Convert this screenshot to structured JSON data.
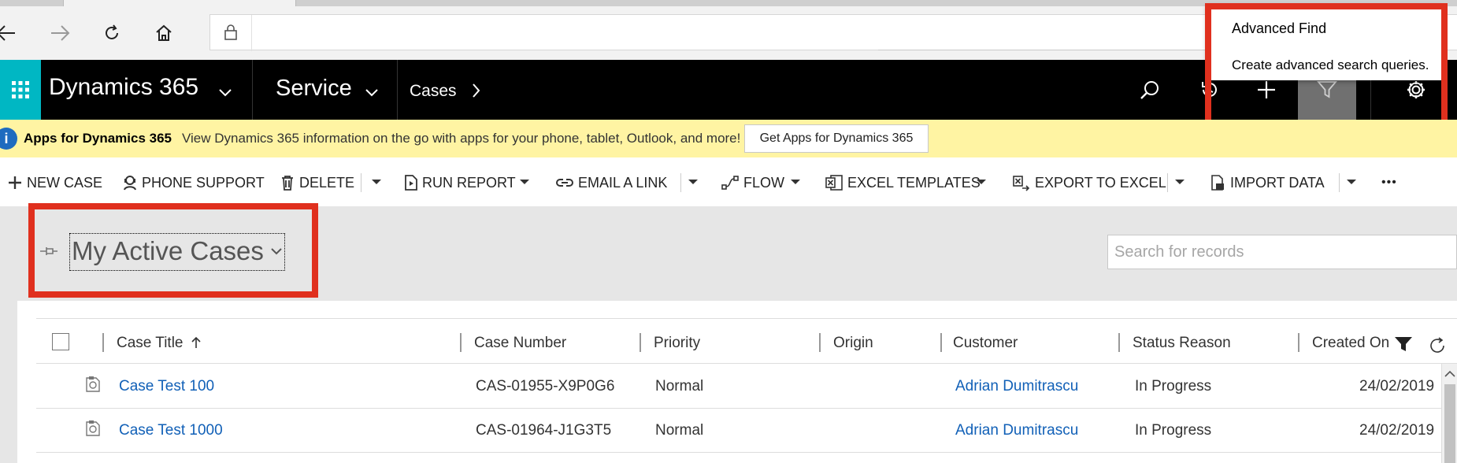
{
  "app": {
    "brand": "Dynamics 365",
    "area": "Service",
    "entity": "Cases"
  },
  "tooltip": {
    "title": "Advanced Find",
    "description": "Create advanced search queries."
  },
  "notification": {
    "title": "Apps for Dynamics 365",
    "text": "View Dynamics 365 information on the go with apps for your phone, tablet, Outlook, and more!",
    "button": "Get Apps for Dynamics 365"
  },
  "commands": {
    "new_case": "NEW CASE",
    "phone_support": "PHONE SUPPORT",
    "delete": "DELETE",
    "run_report": "RUN REPORT",
    "email_link": "EMAIL A LINK",
    "flow": "FLOW",
    "excel_templates": "EXCEL TEMPLATES",
    "export_excel": "EXPORT TO EXCEL",
    "import_data": "IMPORT DATA",
    "more": "•••"
  },
  "view": {
    "title": "My Active Cases",
    "search_placeholder": "Search for records"
  },
  "grid": {
    "columns": {
      "title": "Case Title",
      "number": "Case Number",
      "priority": "Priority",
      "origin": "Origin",
      "customer": "Customer",
      "status": "Status Reason",
      "created": "Created On"
    },
    "rows": [
      {
        "title": "Case Test 100",
        "number": "CAS-01955-X9P0G6",
        "priority": "Normal",
        "origin": "",
        "customer": "Adrian Dumitrascu",
        "status": "In Progress",
        "created": "24/02/2019"
      },
      {
        "title": "Case Test 1000",
        "number": "CAS-01964-J1G3T5",
        "priority": "Normal",
        "origin": "",
        "customer": "Adrian Dumitrascu",
        "status": "In Progress",
        "created": "24/02/2019"
      }
    ]
  },
  "colors": {
    "accent": "#00b7c3",
    "highlight": "#e0301e",
    "link": "#1160b7",
    "notification_bg": "#fff4a3"
  }
}
